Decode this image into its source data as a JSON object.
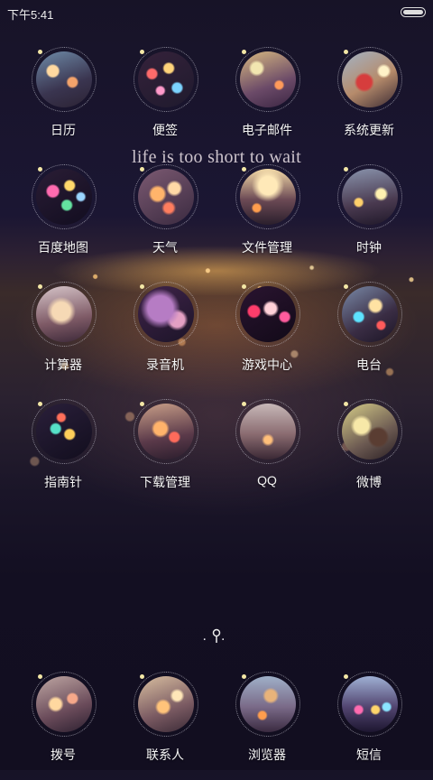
{
  "status_bar": {
    "time": "下午5:41"
  },
  "motto": "life is too short to wait",
  "grid": [
    {
      "label": "日历",
      "style": "b1",
      "icon": "calendar-icon"
    },
    {
      "label": "便签",
      "style": "b2",
      "icon": "notes-icon"
    },
    {
      "label": "电子邮件",
      "style": "b3",
      "icon": "email-icon"
    },
    {
      "label": "系统更新",
      "style": "b4",
      "icon": "system-update-icon"
    },
    {
      "label": "百度地图",
      "style": "b5",
      "icon": "baidu-map-icon"
    },
    {
      "label": "天气",
      "style": "b6",
      "icon": "weather-icon"
    },
    {
      "label": "文件管理",
      "style": "b7",
      "icon": "file-manager-icon"
    },
    {
      "label": "时钟",
      "style": "b8",
      "icon": "clock-icon"
    },
    {
      "label": "计算器",
      "style": "b9",
      "icon": "calculator-icon"
    },
    {
      "label": "录音机",
      "style": "b10",
      "icon": "recorder-icon"
    },
    {
      "label": "游戏中心",
      "style": "b11",
      "icon": "game-center-icon"
    },
    {
      "label": "电台",
      "style": "b12",
      "icon": "radio-icon"
    },
    {
      "label": "指南针",
      "style": "b13",
      "icon": "compass-icon"
    },
    {
      "label": "下载管理",
      "style": "b14",
      "icon": "download-manager-icon"
    },
    {
      "label": "QQ",
      "style": "b15",
      "icon": "qq-icon"
    },
    {
      "label": "微博",
      "style": "b16",
      "icon": "weibo-icon"
    }
  ],
  "dock": [
    {
      "label": "拨号",
      "style": "b17",
      "icon": "dialer-icon"
    },
    {
      "label": "联系人",
      "style": "b18",
      "icon": "contacts-icon"
    },
    {
      "label": "浏览器",
      "style": "b19",
      "icon": "browser-icon"
    },
    {
      "label": "短信",
      "style": "b20",
      "icon": "messages-icon"
    }
  ]
}
